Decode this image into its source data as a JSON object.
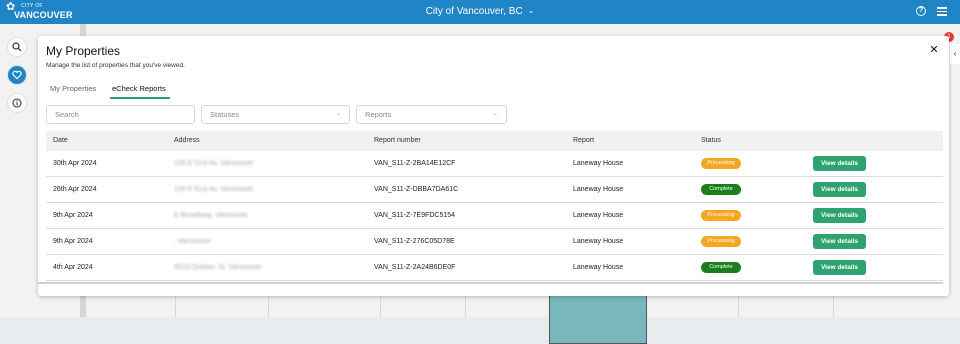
{
  "topbar": {
    "logo_city": "CITY OF",
    "logo_name": "VANCOUVER",
    "location": "City of Vancouver, BC",
    "chevron_icon": "chevron-down-icon",
    "help_icon": "help-circle-icon",
    "menu_icon": "hamburger-menu-icon"
  },
  "rail": {
    "items": [
      {
        "icon": "search-icon"
      },
      {
        "icon": "heart-icon",
        "active": true
      },
      {
        "icon": "info-icon"
      }
    ]
  },
  "panel": {
    "title": "My Properties",
    "subtitle": "Manage the list of properties that you've viewed.",
    "tabs": [
      {
        "label": "My Properties"
      },
      {
        "label": "eCheck Reports",
        "active": true
      }
    ],
    "filters": {
      "search_placeholder": "Search",
      "statuses_placeholder": "Statuses",
      "reports_placeholder": "Reports"
    },
    "columns": [
      "Date",
      "Address",
      "Report number",
      "Report",
      "Status"
    ],
    "rows": [
      {
        "date": "30th Apr 2024",
        "address": "135 E 51st Av, Vancouver",
        "number": "VAN_S11-Z-2BA14E12CF",
        "report": "Laneway House",
        "status": "Processing",
        "action": "View details"
      },
      {
        "date": "26th Apr 2024",
        "address": "135 E 51st Av, Vancouver",
        "number": "VAN_S11-Z-DBBA7DA61C",
        "report": "Laneway House",
        "status": "Complete",
        "action": "View details"
      },
      {
        "date": "9th Apr 2024",
        "address": "E Broadway, Vancouver",
        "number": "VAN_S11-Z-7E9FDC5154",
        "report": "Laneway House",
        "status": "Processing",
        "action": "View details"
      },
      {
        "date": "9th Apr 2024",
        "address": ", Vancouver",
        "number": "VAN_S11-Z-276C05D78E",
        "report": "Laneway House",
        "status": "Processing",
        "action": "View details"
      },
      {
        "date": "4th Apr 2024",
        "address": "6023 Quebec St, Vancouver",
        "number": "VAN_S11-Z-2A24B6DE0F",
        "report": "Laneway House",
        "status": "Complete",
        "action": "View details"
      }
    ]
  },
  "colors": {
    "topbar": "#1f85c7",
    "processing": "#f5a623",
    "complete": "#1a7f1a",
    "view_button": "#2ea36f",
    "tab_underline": "#2e9e6e"
  },
  "notification_count": "1"
}
